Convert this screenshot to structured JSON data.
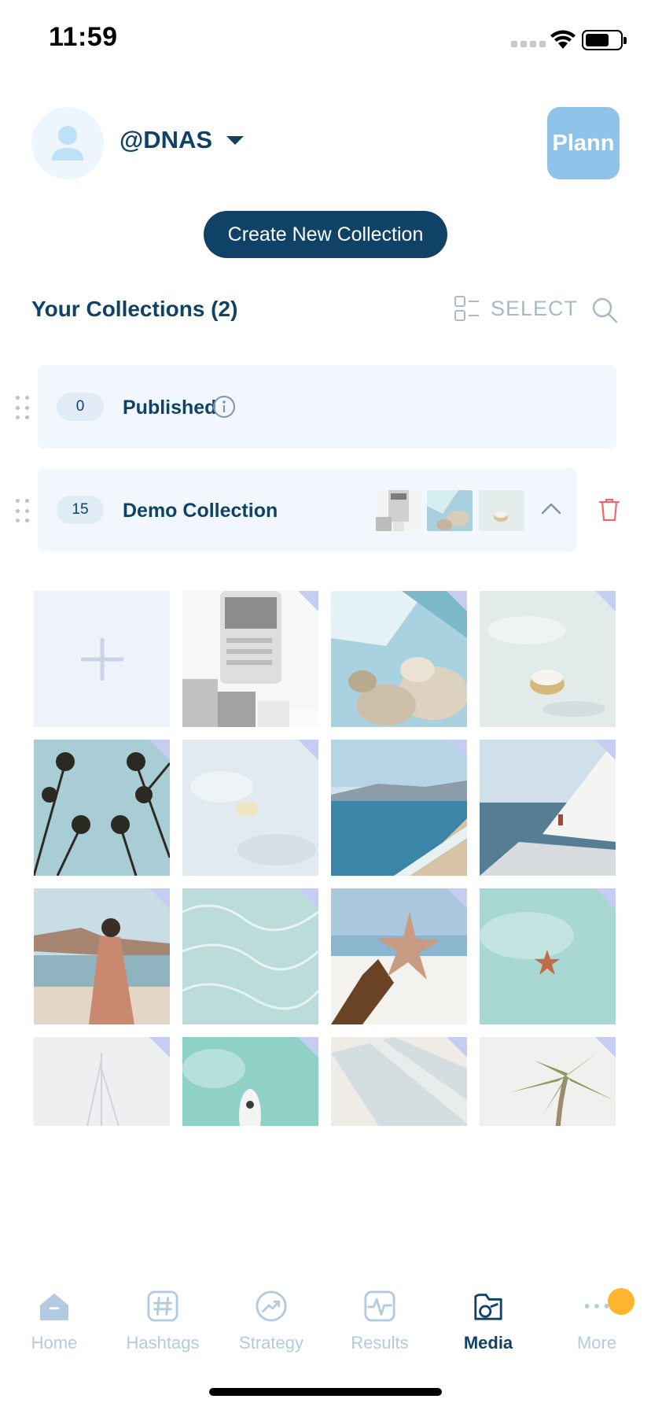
{
  "status": {
    "time": "11:59"
  },
  "header": {
    "account_name": "@DNAS",
    "plann_label": "Plann"
  },
  "actions": {
    "create_label": "Create New Collection"
  },
  "collections": {
    "title": "Your Collections (2)",
    "select_label": "SELECT",
    "rows": [
      {
        "count": "0",
        "label": "Published"
      },
      {
        "count": "15",
        "label": "Demo Collection"
      }
    ]
  },
  "tabs": [
    {
      "label": "Home",
      "icon": "home-icon"
    },
    {
      "label": "Hashtags",
      "icon": "hashtag-icon"
    },
    {
      "label": "Strategy",
      "icon": "strategy-icon"
    },
    {
      "label": "Results",
      "icon": "results-icon"
    },
    {
      "label": "Media",
      "icon": "media-icon",
      "active": true
    },
    {
      "label": "More",
      "icon": "more-icon"
    }
  ],
  "colors": {
    "brand_navy": "#0f4266",
    "plann_blue": "#8fc3ea",
    "card_bg": "#f2f7fd",
    "delete_red": "#e86b6b",
    "notification": "#ffb52e"
  }
}
